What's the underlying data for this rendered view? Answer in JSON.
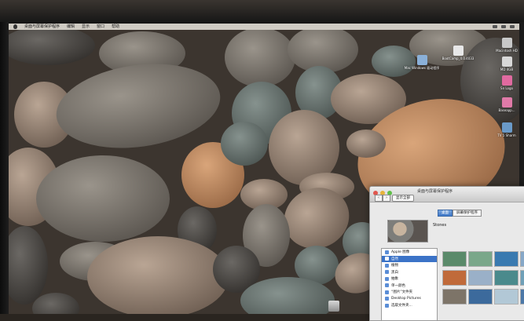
{
  "menubar": {
    "items": [
      "桌面与屏幕保护程序",
      "编辑",
      "显示",
      "窗口",
      "帮助"
    ]
  },
  "desktop": {
    "icons": [
      {
        "label": "Macintosh HD"
      },
      {
        "label": "Mac Windows 驱动程序"
      },
      {
        "label": "BootCamp_4.0.4033"
      },
      {
        "label": "MD 4GB"
      },
      {
        "label": "Sn Logo"
      },
      {
        "label": "Baseapp..."
      },
      {
        "label": "TV 5 Sharm"
      }
    ]
  },
  "prefs_window": {
    "title": "桌面与屏幕保护程序",
    "show_all": "显示全部",
    "tabs": [
      "桌面",
      "屏幕保护程序"
    ],
    "active_tab": 0,
    "wallpaper_name": "Stones",
    "sources": [
      {
        "label": "Apple 图像",
        "selected": false
      },
      {
        "label": "自然",
        "selected": true
      },
      {
        "label": "植物",
        "selected": false
      },
      {
        "label": "黑白",
        "selected": false
      },
      {
        "label": "抽象",
        "selected": false
      },
      {
        "label": "单一颜色",
        "selected": false
      },
      {
        "label": "“图片”文件夹",
        "selected": false
      },
      {
        "label": "Desktop Pictures",
        "selected": false
      },
      {
        "label": "选取文件夹...",
        "selected": false
      }
    ],
    "thumbnails": [
      {
        "color": "#5a8a6a"
      },
      {
        "color": "#7aa78a"
      },
      {
        "color": "#3a7ab0"
      },
      {
        "color": "#86a8c8"
      },
      {
        "color": "#c06a3a"
      },
      {
        "color": "#9ab0c8"
      },
      {
        "color": "#4a8a8c"
      },
      {
        "color": "#6fa0b8"
      },
      {
        "color": "#7d7468"
      },
      {
        "color": "#3c6a9c"
      },
      {
        "color": "#b2c8d6"
      },
      {
        "color": "#4c78a8"
      }
    ]
  },
  "colors": {
    "selection": "#3b73c7",
    "close_light": "#e0564e",
    "min_light": "#e6b23a",
    "zoom_light": "#5fbf49"
  }
}
